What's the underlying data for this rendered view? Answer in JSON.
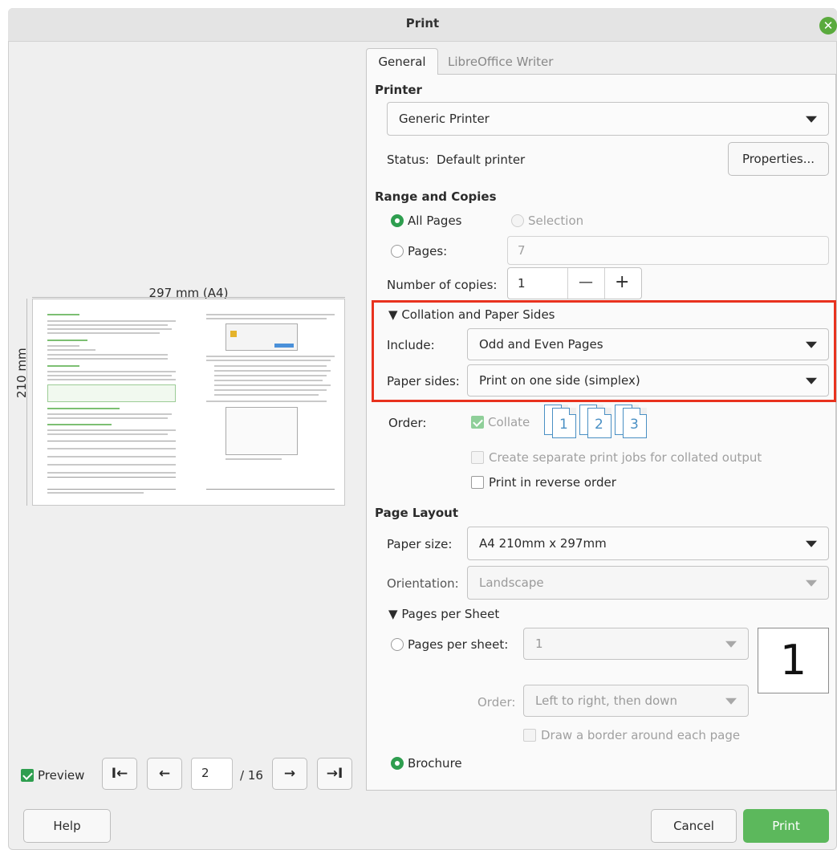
{
  "window": {
    "title": "Print"
  },
  "tabs": [
    "General",
    "LibreOffice Writer"
  ],
  "printer": {
    "section_title": "Printer",
    "selected": "Generic Printer",
    "status_label": "Status:",
    "status_value": "Default printer",
    "properties_button": "Properties..."
  },
  "range": {
    "section_title": "Range and Copies",
    "all_pages": "All Pages",
    "selection": "Selection",
    "pages_label": "Pages:",
    "pages_placeholder": "7",
    "copies_label": "Number of copies:",
    "copies_value": "1",
    "minus": "—",
    "plus": "+"
  },
  "collation": {
    "section_title": "Collation and Paper Sides",
    "include_label": "Include:",
    "include_value": "Odd and Even Pages",
    "sides_label": "Paper sides:",
    "sides_value": "Print on one side (simplex)",
    "highlight_color": "#e8321e",
    "order_label": "Order:",
    "collate": "Collate",
    "collate_pages": [
      "1",
      "2",
      "3"
    ],
    "separate_jobs": "Create separate print jobs for collated output",
    "reverse_order": "Print in reverse order"
  },
  "layout": {
    "section_title": "Page Layout",
    "paper_size_label": "Paper size:",
    "paper_size_value": "A4 210mm x 297mm",
    "orientation_label": "Orientation:",
    "orientation_value": "Landscape",
    "pps_section": "Pages per Sheet",
    "pps_label": "Pages per sheet:",
    "pps_value": "1",
    "pps_preview": "1",
    "order_label": "Order:",
    "order_value": "Left to right, then down",
    "border": "Draw a border around each page",
    "brochure": "Brochure"
  },
  "preview": {
    "width_label": "297 mm (A4)",
    "height_label": "210 mm",
    "preview_toggle": "Preview",
    "first_icon": "first-page-icon",
    "prev_icon": "previous-page-icon",
    "next_icon": "next-page-icon",
    "last_icon": "last-page-icon",
    "page_value": "2",
    "page_total": "/ 16"
  },
  "footer": {
    "help": "Help",
    "cancel": "Cancel",
    "print": "Print",
    "accent": "#5cb85c"
  }
}
